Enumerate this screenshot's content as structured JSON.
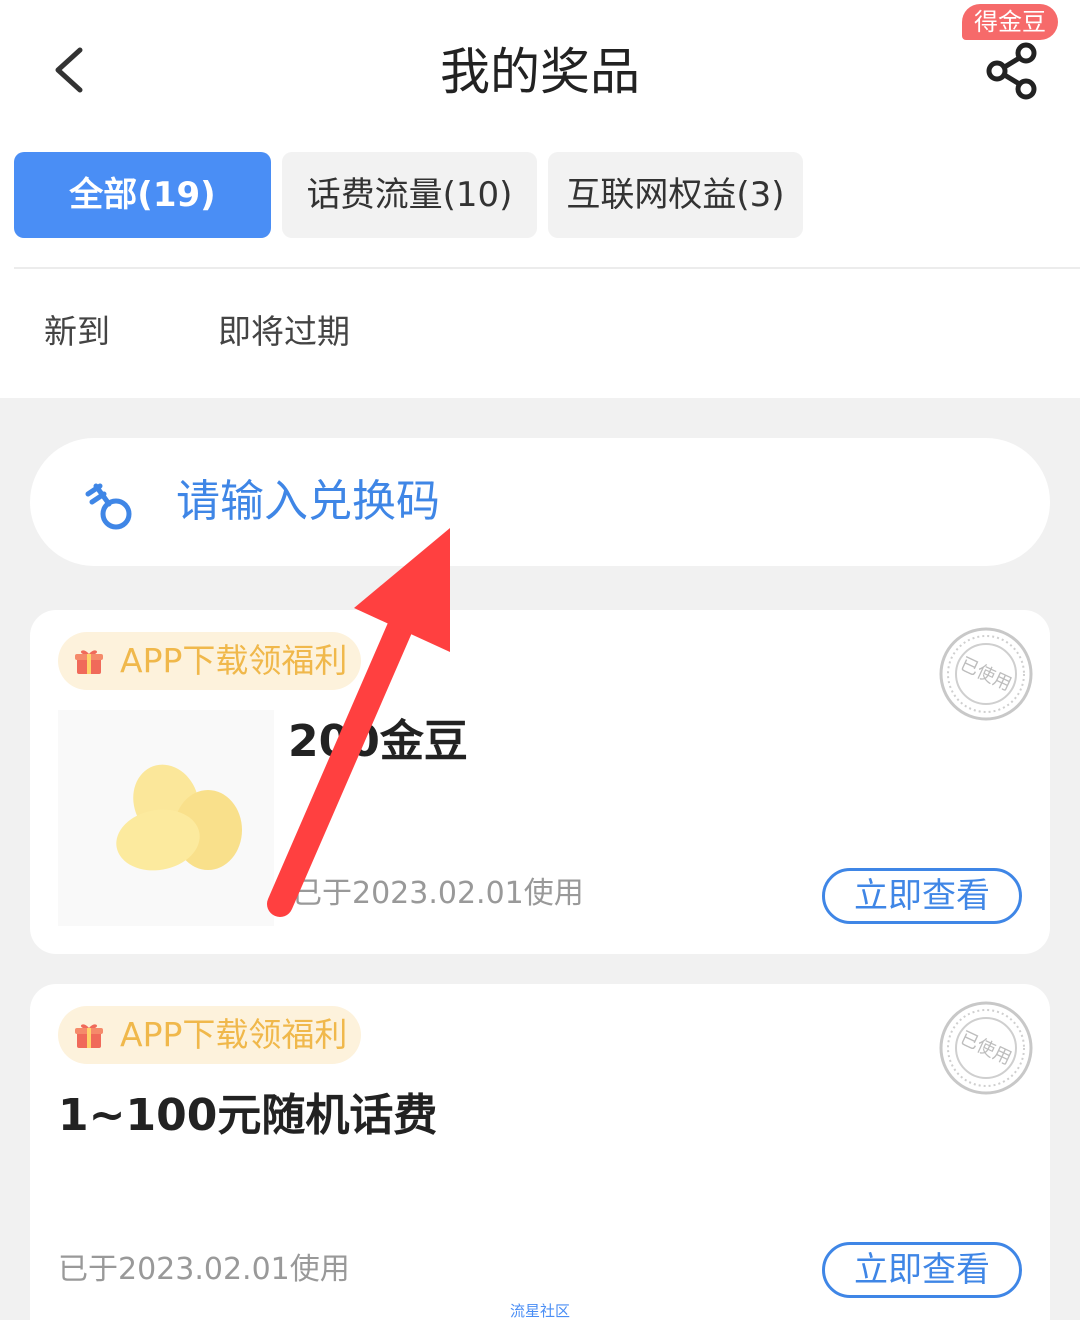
{
  "header": {
    "title": "我的奖品",
    "gold_badge": "得金豆"
  },
  "category_tabs": [
    {
      "label": "全部(19)",
      "active": true
    },
    {
      "label": "话费流量(10)",
      "active": false
    },
    {
      "label": "互联网权益(3)",
      "active": false
    }
  ],
  "sort_tabs": [
    {
      "label": "新到"
    },
    {
      "label": "即将过期"
    }
  ],
  "redeem": {
    "placeholder": "请输入兑换码"
  },
  "prizes": [
    {
      "tag": "APP下载领福利",
      "stamp": "已使用",
      "name": "200金豆",
      "used_text": "已于2023.02.01使用",
      "button": "立即查看"
    },
    {
      "tag": "APP下载领福利",
      "stamp": "已使用",
      "name": "1~100元随机话费",
      "used_text": "已于2023.02.01使用",
      "button": "立即查看"
    }
  ],
  "watermark": "流星社区",
  "colors": {
    "accent": "#4a8ef5",
    "link_blue": "#3f86e6",
    "tag_bg": "#fdf2dc",
    "tag_text": "#f0b84b",
    "badge_red": "#f66a6a",
    "annotation_arrow": "#ff4040"
  },
  "icons": [
    "back-arrow-icon",
    "share-icon",
    "key-icon",
    "gift-icon",
    "used-stamp-icon",
    "gold-bean-icon",
    "annotation-arrow-icon"
  ]
}
